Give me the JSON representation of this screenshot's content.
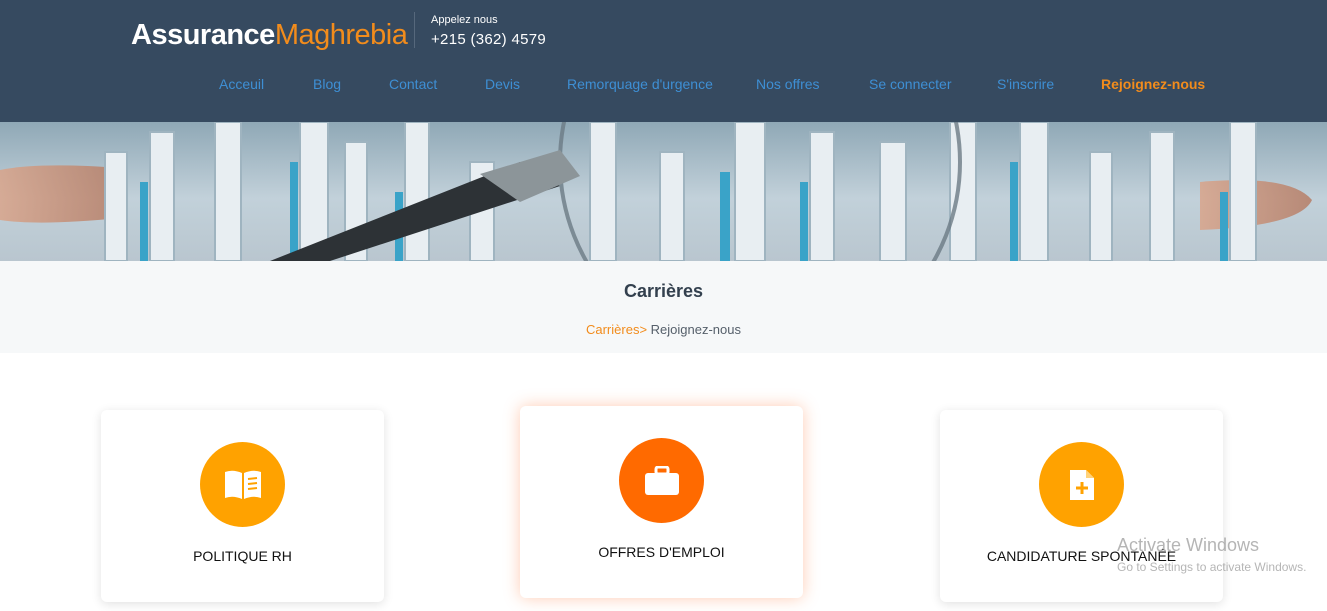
{
  "header": {
    "logo_part1": "Assurance",
    "logo_part2": "Maghrebia",
    "call_label": "Appelez nous",
    "phone": "+215 (362) 4579"
  },
  "nav": {
    "items": [
      {
        "label": "Acceuil"
      },
      {
        "label": "Blog"
      },
      {
        "label": "Contact"
      },
      {
        "label": "Devis"
      },
      {
        "label": "Remorquage d'urgence"
      },
      {
        "label": "Nos offres"
      },
      {
        "label": "Se connecter"
      },
      {
        "label": "S'inscrire"
      },
      {
        "label": "Rejoignez-nous",
        "active": true
      }
    ]
  },
  "page": {
    "title": "Carrières",
    "breadcrumb_link": "Carrières>",
    "breadcrumb_current": "Rejoignez-nous"
  },
  "cards": [
    {
      "label": "POLITIQUE RH",
      "icon": "book-icon",
      "color": "#ffa200"
    },
    {
      "label": "OFFRES D'EMPLOI",
      "icon": "briefcase-icon",
      "color": "#ff6a00"
    },
    {
      "label": "CANDIDATURE SPONTANÉE",
      "icon": "file-plus-icon",
      "color": "#ffa200"
    }
  ],
  "watermark": {
    "line1": "Activate Windows",
    "line2": "Go to Settings to activate Windows."
  },
  "colors": {
    "header_bg": "#364a60",
    "nav_link": "#3e8fd4",
    "accent": "#f28c1c"
  }
}
